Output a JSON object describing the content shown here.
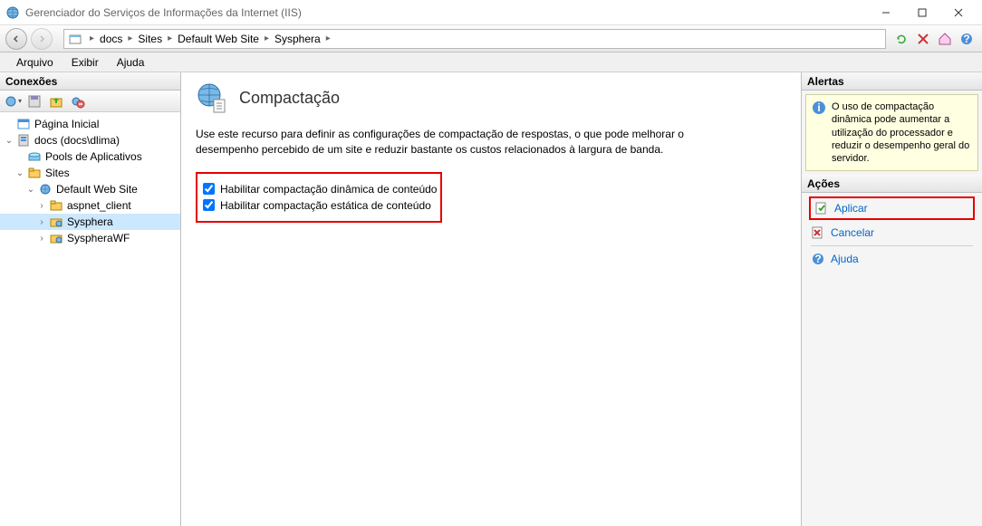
{
  "window": {
    "title": "Gerenciador do Serviços de Informações da Internet (IIS)"
  },
  "breadcrumb": {
    "items": [
      "docs",
      "Sites",
      "Default Web Site",
      "Sysphera"
    ]
  },
  "menu": {
    "file": "Arquivo",
    "view": "Exibir",
    "help": "Ajuda"
  },
  "connections": {
    "title": "Conexões",
    "tree": {
      "start_page": "Página Inicial",
      "server": "docs (docs\\dlima)",
      "app_pools": "Pools de Aplicativos",
      "sites": "Sites",
      "default_site": "Default Web Site",
      "aspnet_client": "aspnet_client",
      "sysphera": "Sysphera",
      "syspherawf": "SyspheraWF"
    }
  },
  "feature": {
    "title": "Compactação",
    "description": "Use este recurso para definir as configurações de compactação de respostas, o que pode melhorar o desempenho percebido de um site e reduzir bastante os custos relacionados à largura de banda.",
    "checkbox_dynamic": "Habilitar compactação dinâmica de conteúdo",
    "checkbox_static": "Habilitar compactação estática de conteúdo"
  },
  "alerts": {
    "title": "Alertas",
    "message": "O uso de compactação dinâmica pode aumentar a utilização do processador e reduzir o desempenho geral do servidor."
  },
  "actions": {
    "title": "Ações",
    "apply": "Aplicar",
    "cancel": "Cancelar",
    "help": "Ajuda"
  }
}
